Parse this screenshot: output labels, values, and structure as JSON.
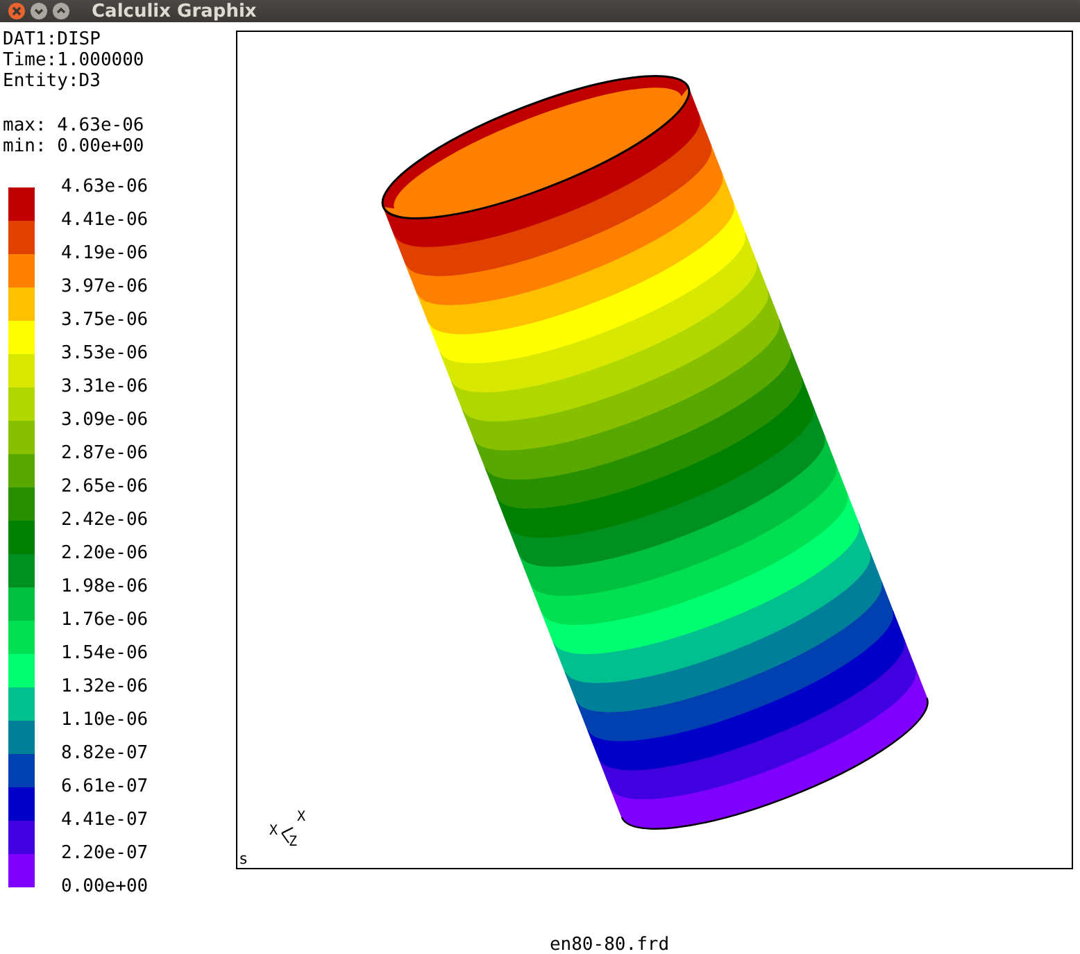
{
  "window": {
    "title": "Calculix Graphix"
  },
  "info": [
    "DAT1:DISP",
    "Time:1.000000",
    "Entity:D3"
  ],
  "extrema": [
    "max: 4.63e-06",
    "min: 0.00e+00"
  ],
  "legend": {
    "labels": [
      "4.63e-06",
      "4.41e-06",
      "4.19e-06",
      "3.97e-06",
      "3.75e-06",
      "3.53e-06",
      "3.31e-06",
      "3.09e-06",
      "2.87e-06",
      "2.65e-06",
      "2.42e-06",
      "2.20e-06",
      "1.98e-06",
      "1.76e-06",
      "1.54e-06",
      "1.32e-06",
      "1.10e-06",
      "8.82e-07",
      "6.61e-07",
      "4.41e-07",
      "2.20e-07",
      "0.00e+00"
    ],
    "swatches": [
      {
        "color": "#c00000"
      },
      {
        "color": "#e04000"
      },
      {
        "color": "#ff8000"
      },
      {
        "color": "#ffc000"
      },
      {
        "color": "#ffff00"
      },
      {
        "color": "#d8e800"
      },
      {
        "color": "#b0d800"
      },
      {
        "color": "#88c000"
      },
      {
        "color": "#58a800"
      },
      {
        "color": "#289000"
      },
      {
        "color": "#008000"
      },
      {
        "color": "#009020"
      },
      {
        "color": "#00c040"
      },
      {
        "color": "#00e050"
      },
      {
        "color": "#00ff70"
      },
      {
        "color": "#00c090"
      },
      {
        "color": "#008098"
      },
      {
        "color": "#0040b0"
      },
      {
        "color": "#0000c8"
      },
      {
        "color": "#4000e0"
      },
      {
        "color": "#8000ff"
      }
    ]
  },
  "viewport": {
    "axis_labels": [
      "X",
      "Z",
      "X"
    ],
    "corner_mark": "s"
  },
  "filename": "en80-80.frd"
}
